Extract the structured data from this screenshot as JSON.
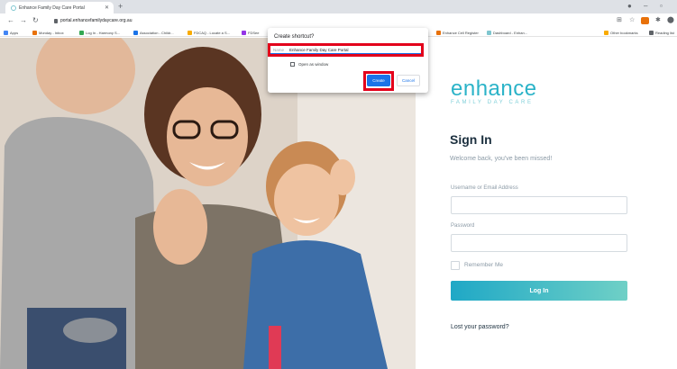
{
  "browser": {
    "tab": {
      "title": "Enhance Family Day Care Portal"
    },
    "url": "portal.enhancefamilydaycare.org.au",
    "bookmarks": [
      {
        "label": "Apps",
        "color": "#4285f4"
      },
      {
        "label": "Monday - Inbox",
        "color": "#e8710a"
      },
      {
        "label": "Log In - Harmony S...",
        "color": "#34a853"
      },
      {
        "label": "Association - Childr...",
        "color": "#1a73e8"
      },
      {
        "label": "FDCAQ - Locate a S...",
        "color": "#f9ab00"
      },
      {
        "label": "FDSee",
        "color": "#9334e6"
      },
      {
        "label": "Enhance Cell Register",
        "color": "#e8710a"
      },
      {
        "label": "Dashboard - Enhan...",
        "color": "#7fc6cf"
      },
      {
        "label": "Other bookmarks",
        "color": "#f9ab00"
      },
      {
        "label": "Reading list",
        "color": "#5f6368"
      }
    ],
    "icons": [
      "back-icon",
      "forward-icon",
      "reload-icon",
      "lock-icon",
      "star-icon",
      "extension-icon",
      "profile-icon",
      "menu-icon"
    ]
  },
  "dialog": {
    "title": "Create shortcut?",
    "name_label": "Name",
    "name_value": "Enhance Family Day Care Portal",
    "open_window_label": "Open as window",
    "create_label": "Create",
    "cancel_label": "Cancel",
    "highlight_color": "#e3001b"
  },
  "page": {
    "logo": "enhance",
    "logo_sub": "FAMILY DAY CARE",
    "heading": "Sign In",
    "welcome": "Welcome back, you've been missed!",
    "username_label": "Username or Email Address",
    "password_label": "Password",
    "remember_label": "Remember Me",
    "login_label": "Log In",
    "lost_password": "Lost your password?",
    "accent": "#2bb3c8"
  }
}
